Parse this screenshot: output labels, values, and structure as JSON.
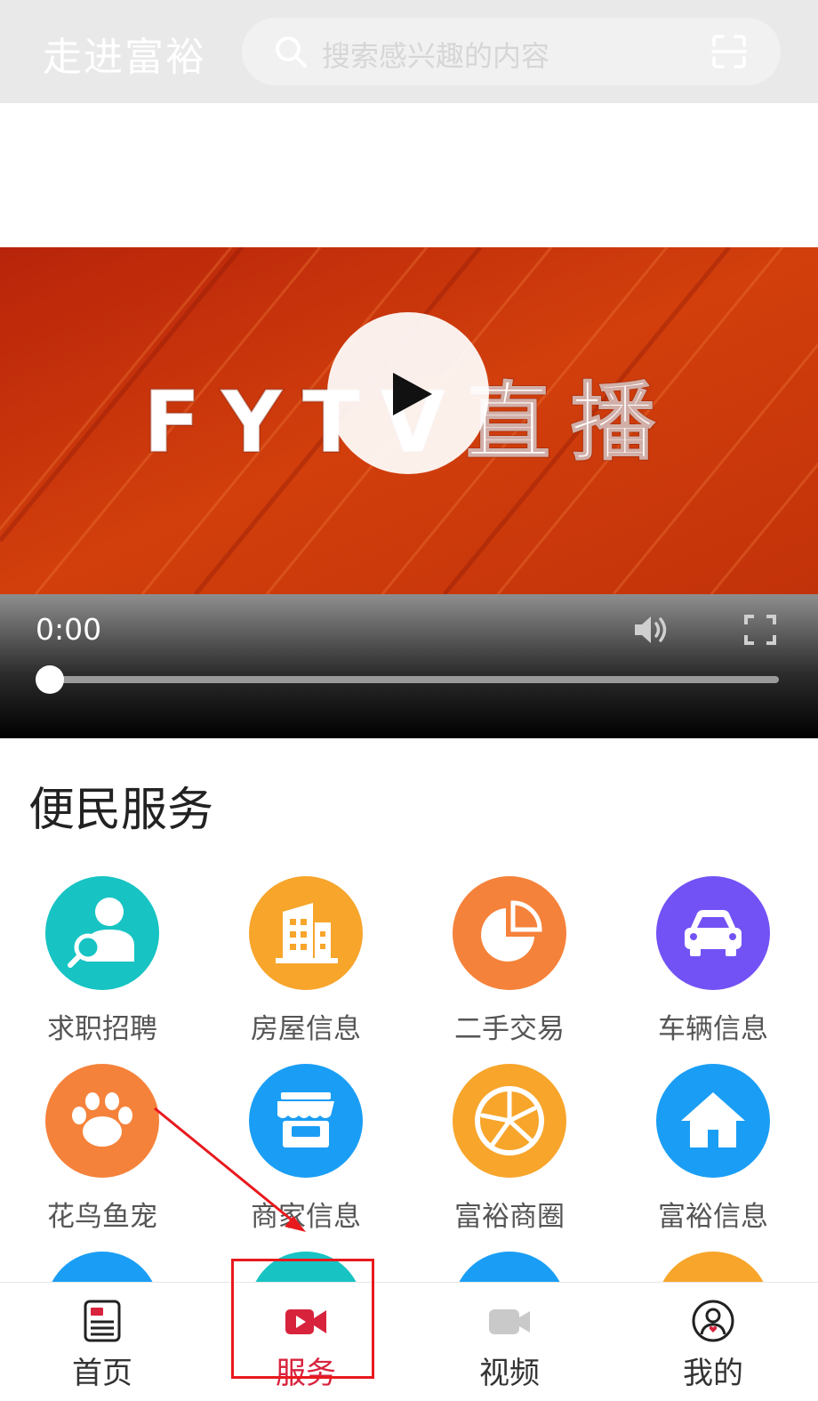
{
  "header": {
    "title": "走进富裕",
    "search_placeholder": "搜索感兴趣的内容"
  },
  "video": {
    "banner_text": "FYTV直播",
    "time": "0:00",
    "progress": 0
  },
  "services": {
    "title": "便民服务",
    "items": [
      {
        "label": "求职招聘",
        "icon": "job-search-icon",
        "color": "#17c3c3"
      },
      {
        "label": "房屋信息",
        "icon": "building-icon",
        "color": "#f7a52b"
      },
      {
        "label": "二手交易",
        "icon": "pie-chart-icon",
        "color": "#f5823b"
      },
      {
        "label": "车辆信息",
        "icon": "car-icon",
        "color": "#7352f5"
      },
      {
        "label": "花鸟鱼宠",
        "icon": "paw-icon",
        "color": "#f5823b"
      },
      {
        "label": "商家信息",
        "icon": "store-icon",
        "color": "#1a9ef5"
      },
      {
        "label": "富裕商圈",
        "icon": "orange-slice-icon",
        "color": "#f7a52b"
      },
      {
        "label": "富裕信息",
        "icon": "house-icon",
        "color": "#1a9ef5"
      }
    ],
    "peek_colors": [
      "#1a9ef5",
      "#17c3c3",
      "#1a9ef5",
      "#f7a52b"
    ]
  },
  "bottom_nav": {
    "items": [
      {
        "label": "首页",
        "icon": "news-icon"
      },
      {
        "label": "服务",
        "icon": "video-camera-icon",
        "active": true
      },
      {
        "label": "视频",
        "icon": "camera-icon"
      },
      {
        "label": "我的",
        "icon": "user-icon"
      }
    ]
  },
  "colors": {
    "accent": "#d8233d",
    "annotation": "#e8191d"
  }
}
